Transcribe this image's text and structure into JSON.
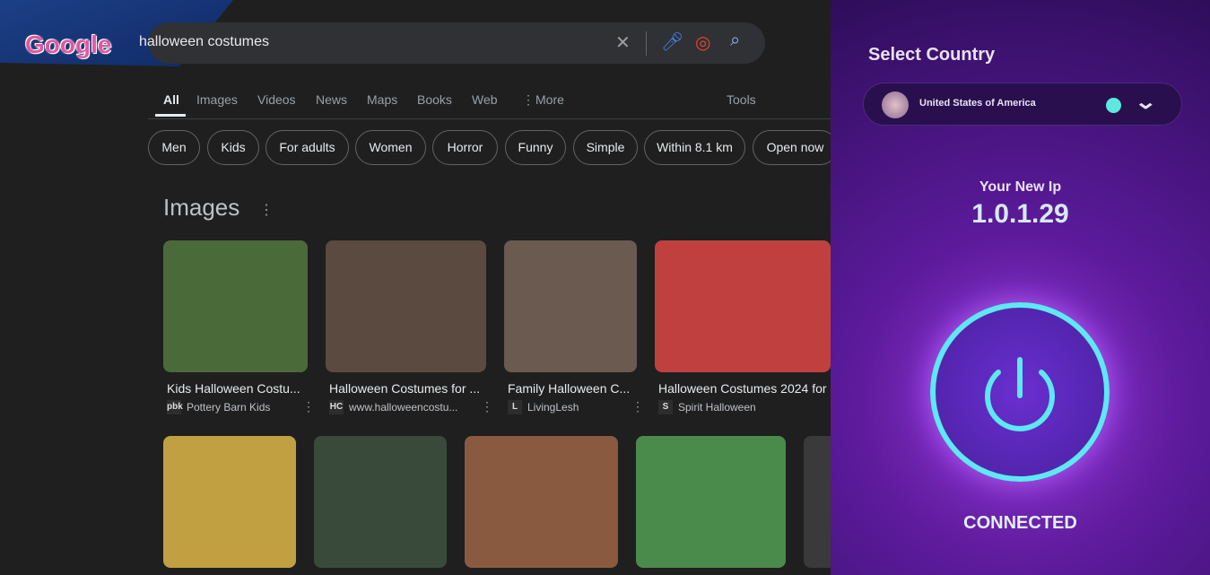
{
  "google": {
    "logo": "Google",
    "query": "halloween costumes",
    "tabs": [
      "All",
      "Images",
      "Videos",
      "News",
      "Maps",
      "Books",
      "Web",
      "More",
      "Tools"
    ],
    "chips": [
      "Men",
      "Kids",
      "For adults",
      "Women",
      "Horror",
      "Funny",
      "Simple",
      "Within 8.1 km",
      "Open now"
    ],
    "images_heading": "Images",
    "row1": [
      {
        "title": "Kids Halloween Costu...",
        "source": "Pottery Barn Kids",
        "fav": "pbk",
        "color": "#4a6a3a"
      },
      {
        "title": "Halloween Costumes for ...",
        "source": "www.halloweencostu...",
        "fav": "HC",
        "color": "#5a4a40"
      },
      {
        "title": "Family Halloween C...",
        "source": "LivingLesh",
        "fav": "L",
        "color": "#6a5a50"
      },
      {
        "title": "Halloween Costumes 2024 for",
        "source": "Spirit Halloween",
        "fav": "S",
        "color": "#c04040"
      }
    ],
    "row2_colors": [
      "#c0a040",
      "#3a4a3a",
      "#8a5a40",
      "#4a8a4a",
      "#3a3a3a"
    ]
  },
  "vpn": {
    "select_label": "Select Country",
    "country": "United States of America",
    "ip_label": "Your New Ip",
    "ip": "1.0.1.29",
    "status": "CONNECTED",
    "accent": "#5ee8f2"
  }
}
